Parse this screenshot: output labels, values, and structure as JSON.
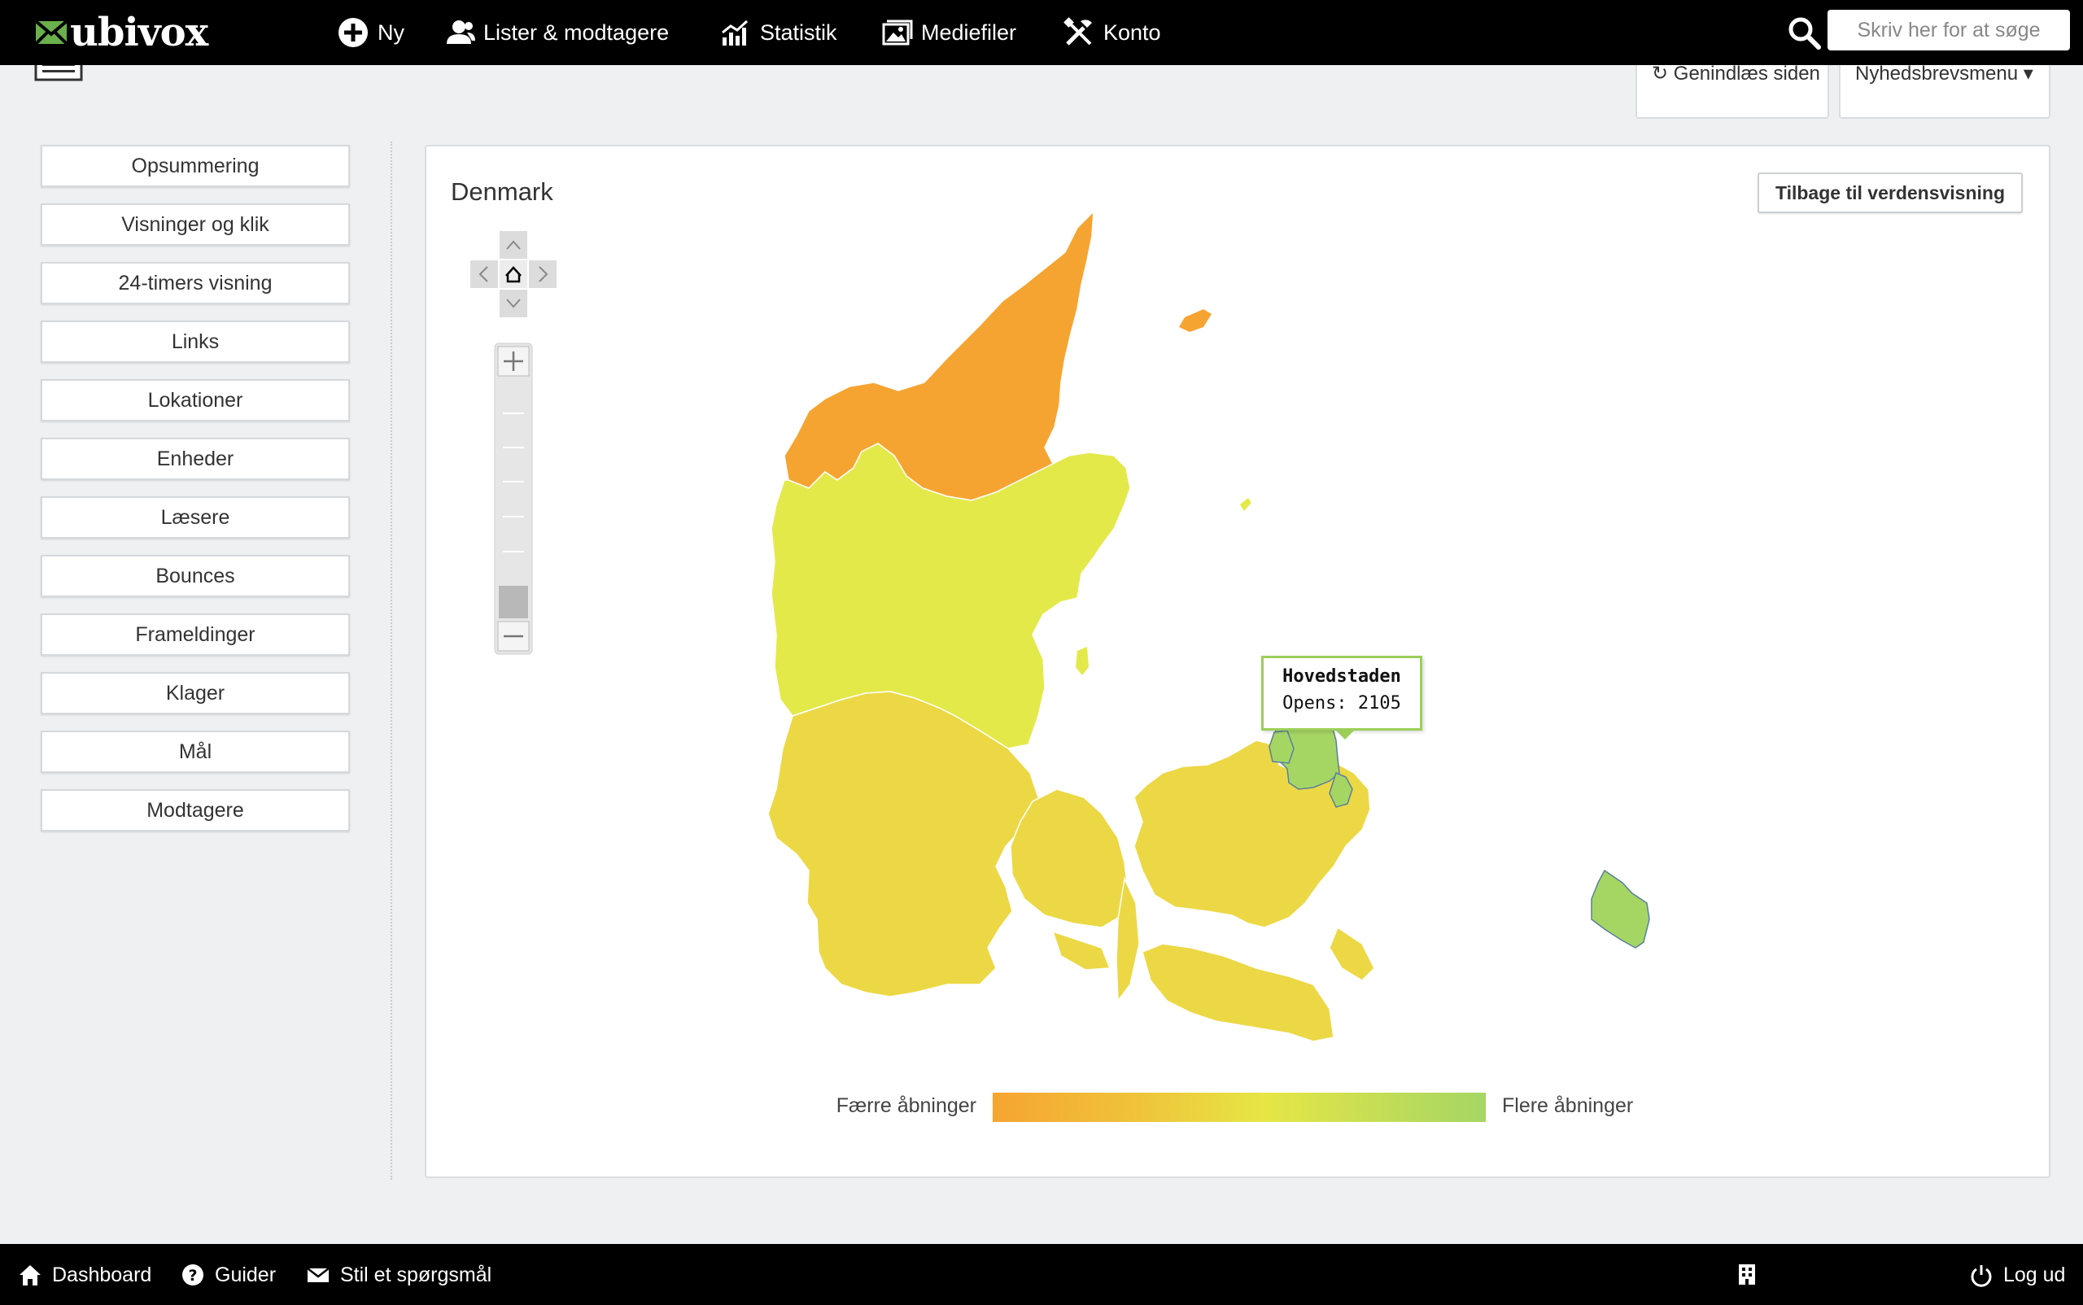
{
  "brand": {
    "name": "ubivox"
  },
  "topnav": {
    "items": [
      {
        "label": "Ny",
        "icon": "plus-circle-icon"
      },
      {
        "label": "Lister & modtagere",
        "icon": "users-icon"
      },
      {
        "label": "Statistik",
        "icon": "chart-icon"
      },
      {
        "label": "Mediefiler",
        "icon": "images-icon"
      },
      {
        "label": "Konto",
        "icon": "tools-icon"
      }
    ],
    "search_placeholder": "Skriv her for at søge"
  },
  "header_actions": {
    "reload_label": "↻ Genindlæs siden",
    "menu_label": "Nyhedsbrevsmenu ▾"
  },
  "sidebar": {
    "items": [
      {
        "label": "Opsummering"
      },
      {
        "label": "Visninger og klik"
      },
      {
        "label": "24-timers visning"
      },
      {
        "label": "Links"
      },
      {
        "label": "Lokationer"
      },
      {
        "label": "Enheder"
      },
      {
        "label": "Læsere"
      },
      {
        "label": "Bounces"
      },
      {
        "label": "Frameldinger"
      },
      {
        "label": "Klager"
      },
      {
        "label": "Mål"
      },
      {
        "label": "Modtagere"
      }
    ]
  },
  "map": {
    "title": "Denmark",
    "back_button": "Tilbage til verdensvisning",
    "legend": {
      "low": "Færre åbninger",
      "high": "Flere åbninger"
    },
    "colors": {
      "nordjylland": "#f6a431",
      "midtjylland": "#e4e94a",
      "syddanmark": "#ecd844",
      "sjaelland": "#ecd844",
      "hovedstaden": "#a5d664"
    },
    "tooltip": {
      "region": "Hovedstaden",
      "label": "Opens: 2105"
    }
  },
  "bottomnav": {
    "items": [
      {
        "label": "Dashboard",
        "icon": "home-icon"
      },
      {
        "label": "Guider",
        "icon": "question-icon"
      },
      {
        "label": "Stil et spørgsmål",
        "icon": "mail-icon"
      }
    ],
    "logout_label": "Log ud"
  }
}
